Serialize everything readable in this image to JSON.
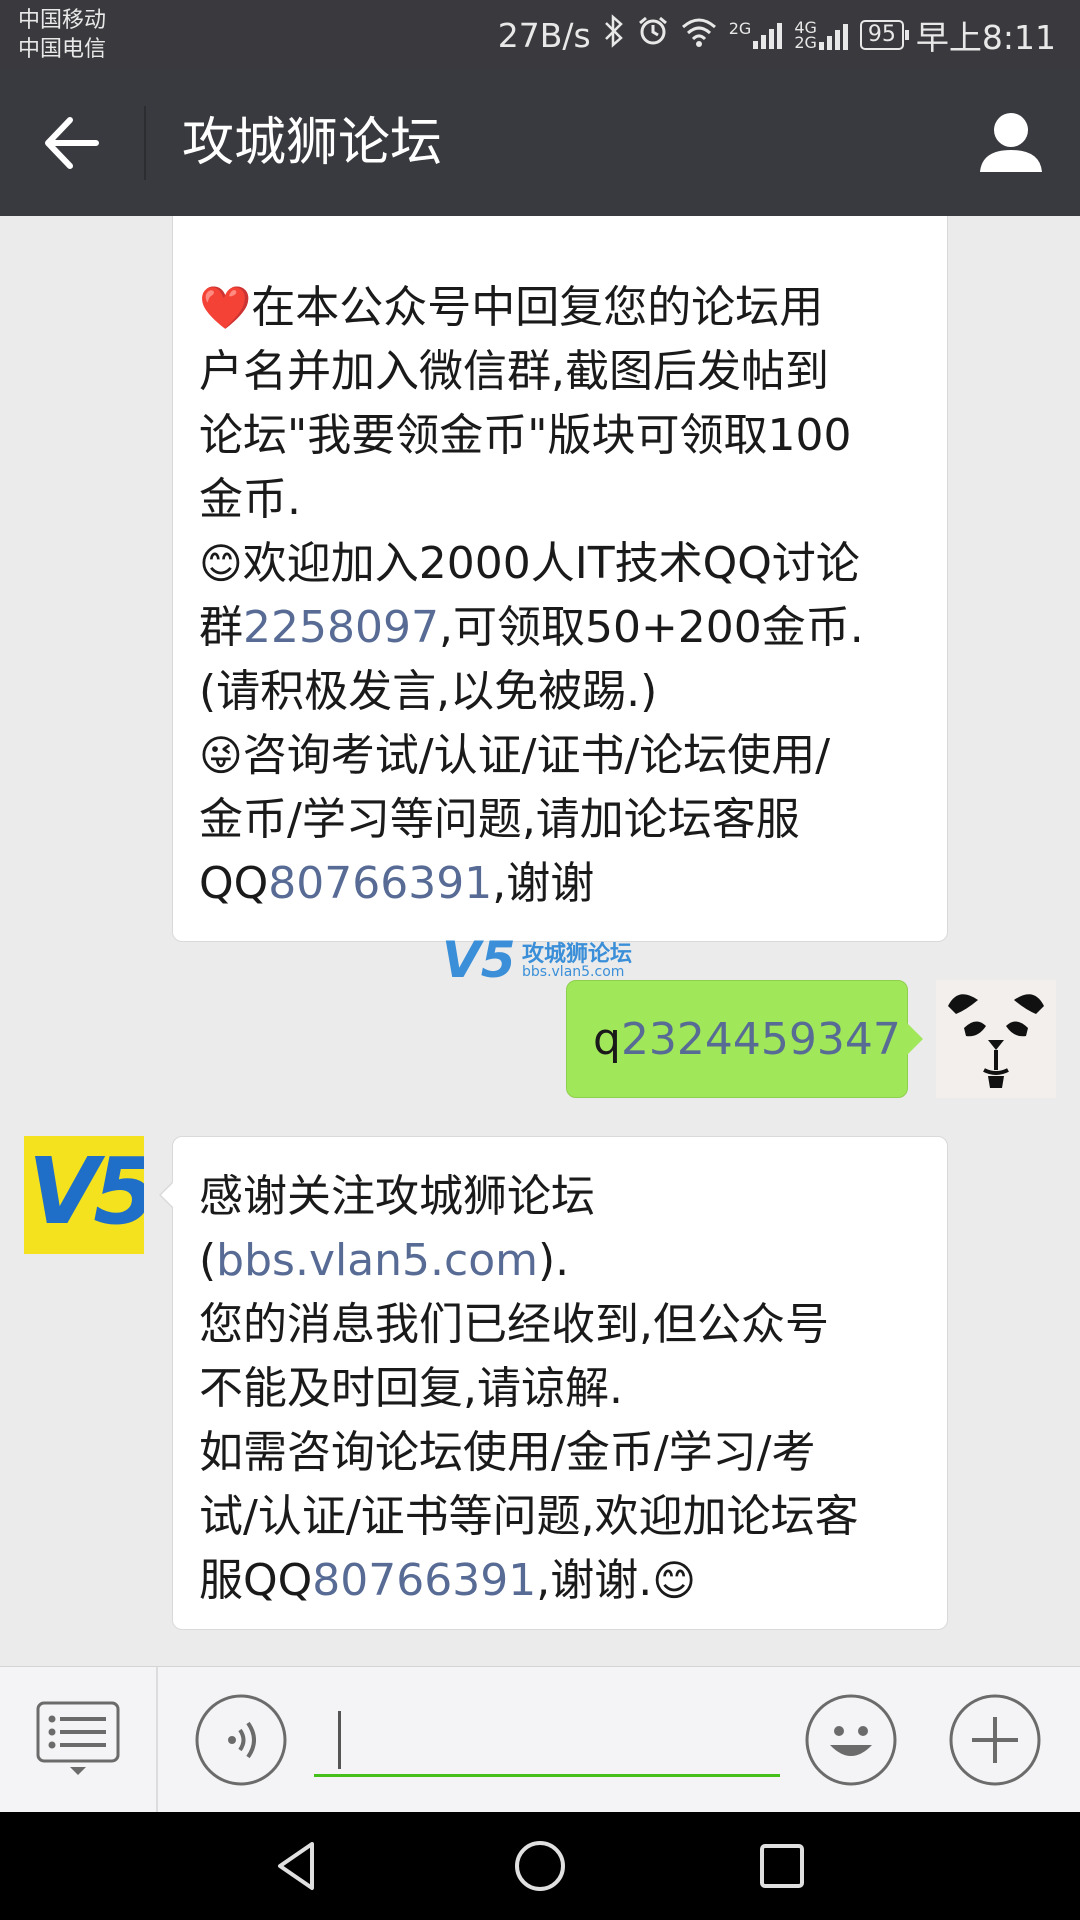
{
  "status_bar": {
    "carrier_1": "中国移动",
    "carrier_2": "中国电信",
    "net_speed": "27B/s",
    "sig1_label": "2G",
    "sig2_label_top": "4G",
    "sig2_label_bottom": "2G",
    "battery": "95",
    "time": "早上8:11"
  },
  "header": {
    "title": "攻城狮论坛",
    "back_icon": "back-arrow-icon",
    "profile_icon": "person-icon"
  },
  "messages": {
    "m1": {
      "heart": "❤️",
      "l1": "在本公众号中回复您的论坛用",
      "l2": "户名并加入微信群,截图后发帖到",
      "l3": "论坛\"我要领金币\"版块可领取100",
      "l4": "金币.",
      "smile": "😊",
      "l5": "欢迎加入2000人IT技术QQ讨论",
      "l6a": "群",
      "l6_link": "2258097",
      "l6b": ",可领取50+200金币.",
      "l7": "(请积极发言,以免被踢.)",
      "wink": "😜",
      "l8": "咨询考试/认证/证书/论坛使用/",
      "l9": "金币/学习等问题,请加论坛客服",
      "l10a": "QQ",
      "l10_link": "80766391",
      "l10b": ",谢谢"
    },
    "m2": {
      "prefix": "q",
      "link": "2324459347"
    },
    "m3": {
      "l1": "感谢关注攻城狮论坛",
      "l2a": "(",
      "l2_link": "bbs.vlan5.com",
      "l2b": ").",
      "l3": "您的消息我们已经收到,但公众号",
      "l4": "不能及时回复,请谅解.",
      "l5": "如需咨询论坛使用/金币/学习/考",
      "l6": "试/认证/证书等问题,欢迎加论坛客",
      "l7a": "服QQ",
      "l7_link": "80766391",
      "l7b": ",谢谢.",
      "smile": "😊"
    }
  },
  "watermark": {
    "logo": "V5",
    "title": "攻城狮论坛",
    "url": "bbs.vlan5.com"
  },
  "avatars": {
    "v5_text": "V5"
  },
  "input_bar": {
    "value": "",
    "menu_icon": "menu-list-icon",
    "voice_icon": "voice-icon",
    "emoji_icon": "emoji-icon",
    "plus_icon": "plus-icon"
  },
  "colors": {
    "header_bg": "#393a3f",
    "link": "#576b95",
    "sent_bubble": "#a0e75a",
    "input_underline": "#45c01a"
  }
}
